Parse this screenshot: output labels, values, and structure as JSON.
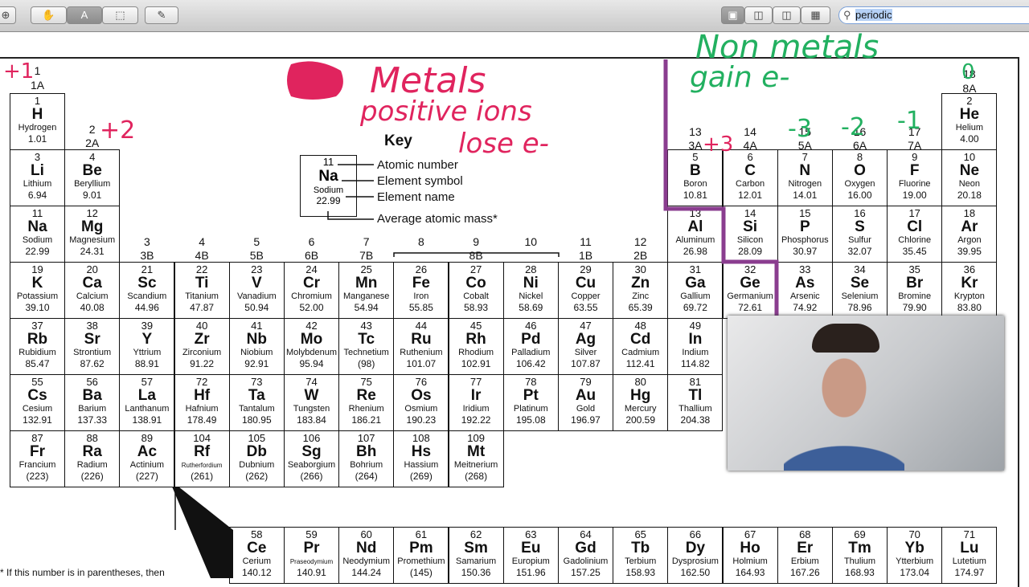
{
  "toolbar": {
    "zoom_icon": "zoom-icon",
    "tools": [
      "hand-tool",
      "text-select-tool",
      "rect-select-tool",
      "annotate-tool"
    ],
    "views": [
      "single-page",
      "two-pages",
      "facing-pages",
      "contact-sheet"
    ],
    "search_value": "periodic"
  },
  "key": {
    "title": "Key",
    "number": "11",
    "symbol": "Na",
    "name": "Sodium",
    "mass": "22.99",
    "labels": [
      "Atomic number",
      "Element symbol",
      "Element name",
      "Average atomic mass*"
    ]
  },
  "groups": [
    [
      "1",
      "1A"
    ],
    [
      "2",
      "2A"
    ],
    [
      "3",
      "3B"
    ],
    [
      "4",
      "4B"
    ],
    [
      "5",
      "5B"
    ],
    [
      "6",
      "6B"
    ],
    [
      "7",
      "7B"
    ],
    [
      "8",
      ""
    ],
    [
      "9",
      "8B"
    ],
    [
      "10",
      ""
    ],
    [
      "11",
      "1B"
    ],
    [
      "12",
      "2B"
    ],
    [
      "13",
      "3A"
    ],
    [
      "14",
      "4A"
    ],
    [
      "15",
      "5A"
    ],
    [
      "16",
      "6A"
    ],
    [
      "17",
      "7A"
    ],
    [
      "18",
      "8A"
    ]
  ],
  "elements": [
    [
      "1",
      "H",
      "Hydrogen",
      "1.01",
      1,
      1
    ],
    [
      "2",
      "He",
      "Helium",
      "4.00",
      1,
      18
    ],
    [
      "3",
      "Li",
      "Lithium",
      "6.94",
      2,
      1
    ],
    [
      "4",
      "Be",
      "Beryllium",
      "9.01",
      2,
      2
    ],
    [
      "5",
      "B",
      "Boron",
      "10.81",
      2,
      13
    ],
    [
      "6",
      "C",
      "Carbon",
      "12.01",
      2,
      14
    ],
    [
      "7",
      "N",
      "Nitrogen",
      "14.01",
      2,
      15
    ],
    [
      "8",
      "O",
      "Oxygen",
      "16.00",
      2,
      16
    ],
    [
      "9",
      "F",
      "Fluorine",
      "19.00",
      2,
      17
    ],
    [
      "10",
      "Ne",
      "Neon",
      "20.18",
      2,
      18
    ],
    [
      "11",
      "Na",
      "Sodium",
      "22.99",
      3,
      1
    ],
    [
      "12",
      "Mg",
      "Magnesium",
      "24.31",
      3,
      2
    ],
    [
      "13",
      "Al",
      "Aluminum",
      "26.98",
      3,
      13
    ],
    [
      "14",
      "Si",
      "Silicon",
      "28.09",
      3,
      14
    ],
    [
      "15",
      "P",
      "Phosphorus",
      "30.97",
      3,
      15
    ],
    [
      "16",
      "S",
      "Sulfur",
      "32.07",
      3,
      16
    ],
    [
      "17",
      "Cl",
      "Chlorine",
      "35.45",
      3,
      17
    ],
    [
      "18",
      "Ar",
      "Argon",
      "39.95",
      3,
      18
    ],
    [
      "19",
      "K",
      "Potassium",
      "39.10",
      4,
      1
    ],
    [
      "20",
      "Ca",
      "Calcium",
      "40.08",
      4,
      2
    ],
    [
      "21",
      "Sc",
      "Scandium",
      "44.96",
      4,
      3
    ],
    [
      "22",
      "Ti",
      "Titanium",
      "47.87",
      4,
      4
    ],
    [
      "23",
      "V",
      "Vanadium",
      "50.94",
      4,
      5
    ],
    [
      "24",
      "Cr",
      "Chromium",
      "52.00",
      4,
      6
    ],
    [
      "25",
      "Mn",
      "Manganese",
      "54.94",
      4,
      7
    ],
    [
      "26",
      "Fe",
      "Iron",
      "55.85",
      4,
      8
    ],
    [
      "27",
      "Co",
      "Cobalt",
      "58.93",
      4,
      9
    ],
    [
      "28",
      "Ni",
      "Nickel",
      "58.69",
      4,
      10
    ],
    [
      "29",
      "Cu",
      "Copper",
      "63.55",
      4,
      11
    ],
    [
      "30",
      "Zn",
      "Zinc",
      "65.39",
      4,
      12
    ],
    [
      "31",
      "Ga",
      "Gallium",
      "69.72",
      4,
      13
    ],
    [
      "32",
      "Ge",
      "Germanium",
      "72.61",
      4,
      14
    ],
    [
      "33",
      "As",
      "Arsenic",
      "74.92",
      4,
      15
    ],
    [
      "34",
      "Se",
      "Selenium",
      "78.96",
      4,
      16
    ],
    [
      "35",
      "Br",
      "Bromine",
      "79.90",
      4,
      17
    ],
    [
      "36",
      "Kr",
      "Krypton",
      "83.80",
      4,
      18
    ],
    [
      "37",
      "Rb",
      "Rubidium",
      "85.47",
      5,
      1
    ],
    [
      "38",
      "Sr",
      "Strontium",
      "87.62",
      5,
      2
    ],
    [
      "39",
      "Y",
      "Yttrium",
      "88.91",
      5,
      3
    ],
    [
      "40",
      "Zr",
      "Zirconium",
      "91.22",
      5,
      4
    ],
    [
      "41",
      "Nb",
      "Niobium",
      "92.91",
      5,
      5
    ],
    [
      "42",
      "Mo",
      "Molybdenum",
      "95.94",
      5,
      6
    ],
    [
      "43",
      "Tc",
      "Technetium",
      "(98)",
      5,
      7
    ],
    [
      "44",
      "Ru",
      "Ruthenium",
      "101.07",
      5,
      8
    ],
    [
      "45",
      "Rh",
      "Rhodium",
      "102.91",
      5,
      9
    ],
    [
      "46",
      "Pd",
      "Palladium",
      "106.42",
      5,
      10
    ],
    [
      "47",
      "Ag",
      "Silver",
      "107.87",
      5,
      11
    ],
    [
      "48",
      "Cd",
      "Cadmium",
      "112.41",
      5,
      12
    ],
    [
      "49",
      "In",
      "Indium",
      "114.82",
      5,
      13
    ],
    [
      "55",
      "Cs",
      "Cesium",
      "132.91",
      6,
      1
    ],
    [
      "56",
      "Ba",
      "Barium",
      "137.33",
      6,
      2
    ],
    [
      "57",
      "La",
      "Lanthanum",
      "138.91",
      6,
      3
    ],
    [
      "72",
      "Hf",
      "Hafnium",
      "178.49",
      6,
      4
    ],
    [
      "73",
      "Ta",
      "Tantalum",
      "180.95",
      6,
      5
    ],
    [
      "74",
      "W",
      "Tungsten",
      "183.84",
      6,
      6
    ],
    [
      "75",
      "Re",
      "Rhenium",
      "186.21",
      6,
      7
    ],
    [
      "76",
      "Os",
      "Osmium",
      "190.23",
      6,
      8
    ],
    [
      "77",
      "Ir",
      "Iridium",
      "192.22",
      6,
      9
    ],
    [
      "78",
      "Pt",
      "Platinum",
      "195.08",
      6,
      10
    ],
    [
      "79",
      "Au",
      "Gold",
      "196.97",
      6,
      11
    ],
    [
      "80",
      "Hg",
      "Mercury",
      "200.59",
      6,
      12
    ],
    [
      "81",
      "Tl",
      "Thallium",
      "204.38",
      6,
      13
    ],
    [
      "87",
      "Fr",
      "Francium",
      "(223)",
      7,
      1
    ],
    [
      "88",
      "Ra",
      "Radium",
      "(226)",
      7,
      2
    ],
    [
      "89",
      "Ac",
      "Actinium",
      "(227)",
      7,
      3
    ],
    [
      "104",
      "Rf",
      "Rutherfordium",
      "(261)",
      7,
      4
    ],
    [
      "105",
      "Db",
      "Dubnium",
      "(262)",
      7,
      5
    ],
    [
      "106",
      "Sg",
      "Seaborgium",
      "(266)",
      7,
      6
    ],
    [
      "107",
      "Bh",
      "Bohrium",
      "(264)",
      7,
      7
    ],
    [
      "108",
      "Hs",
      "Hassium",
      "(269)",
      7,
      8
    ],
    [
      "109",
      "Mt",
      "Meitnerium",
      "(268)",
      7,
      9
    ],
    [
      "58",
      "Ce",
      "Cerium",
      "140.12",
      9,
      5
    ],
    [
      "59",
      "Pr",
      "Praseodymium",
      "140.91",
      9,
      6
    ],
    [
      "60",
      "Nd",
      "Neodymium",
      "144.24",
      9,
      7
    ],
    [
      "61",
      "Pm",
      "Promethium",
      "(145)",
      9,
      8
    ],
    [
      "62",
      "Sm",
      "Samarium",
      "150.36",
      9,
      9
    ],
    [
      "63",
      "Eu",
      "Europium",
      "151.96",
      9,
      10
    ],
    [
      "64",
      "Gd",
      "Gadolinium",
      "157.25",
      9,
      11
    ],
    [
      "65",
      "Tb",
      "Terbium",
      "158.93",
      9,
      12
    ],
    [
      "66",
      "Dy",
      "Dysprosium",
      "162.50",
      9,
      13
    ],
    [
      "67",
      "Ho",
      "Holmium",
      "164.93",
      9,
      14
    ],
    [
      "68",
      "Er",
      "Erbium",
      "167.26",
      9,
      15
    ],
    [
      "69",
      "Tm",
      "Thulium",
      "168.93",
      9,
      16
    ],
    [
      "70",
      "Yb",
      "Ytterbium",
      "173.04",
      9,
      17
    ],
    [
      "71",
      "Lu",
      "Lutetium",
      "174.97",
      9,
      18
    ]
  ],
  "footnote": "* If this number is in parentheses, then",
  "annotations": {
    "metals": [
      "Metals",
      "positive ions",
      "lose e-"
    ],
    "nonmetals": [
      "Non metals",
      "gain e-"
    ],
    "charges": [
      "+1",
      "+2",
      "+3",
      "-3",
      "-2",
      "-1",
      "0"
    ]
  },
  "colors": {
    "red_ink": "#e0245e",
    "green_ink": "#22b060",
    "purple_ink": "#8a3d8f"
  }
}
